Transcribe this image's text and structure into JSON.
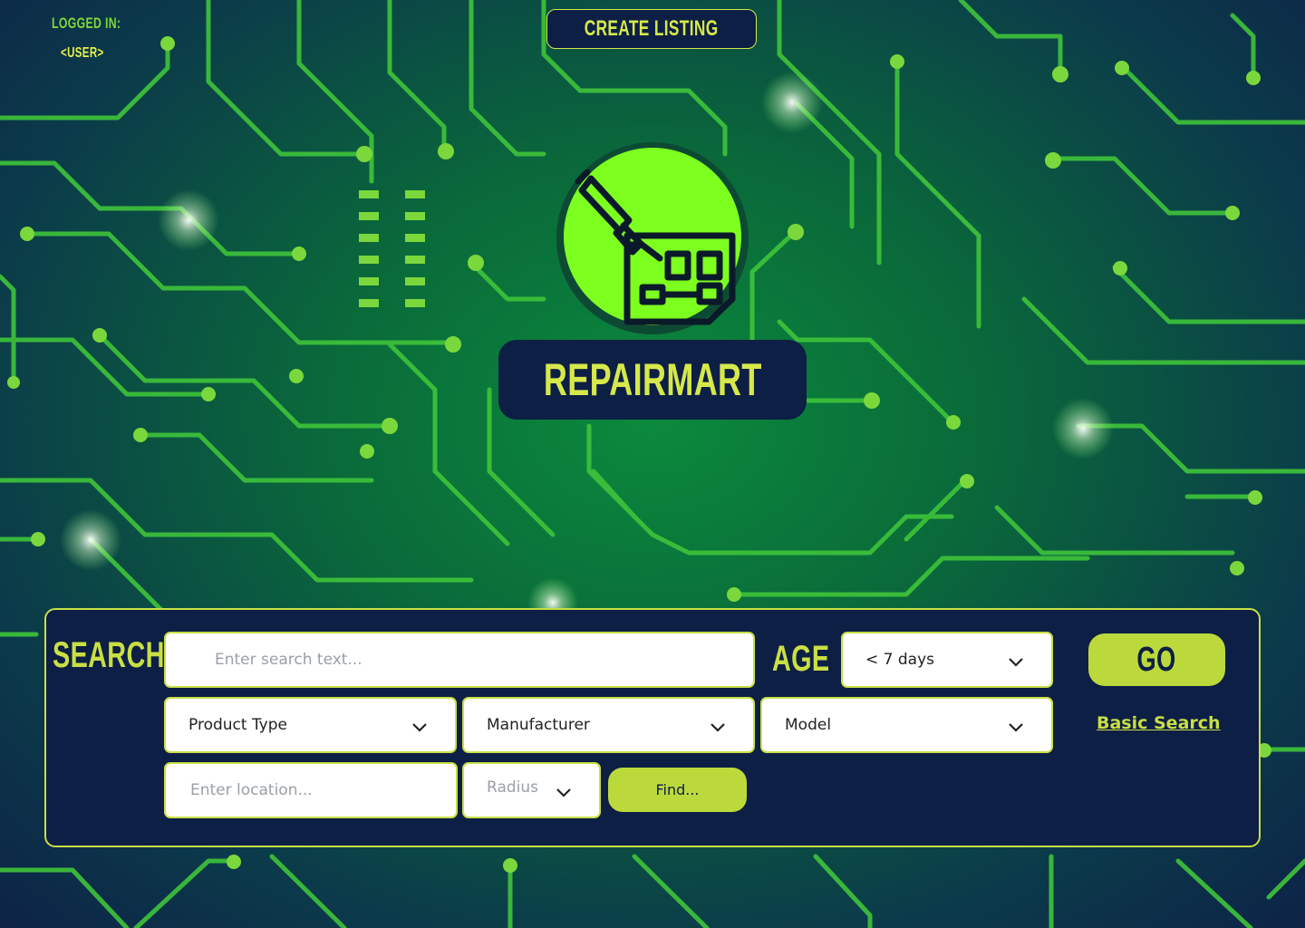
{
  "header": {
    "logged_in_label": "LOGGED IN:",
    "user_link": "<USER>",
    "create_listing": "CREATE LISTING"
  },
  "brand": {
    "name": "REPAIRMART",
    "logo_icon": "soldering-iron-circuit-board-icon"
  },
  "search": {
    "label": "SEARCH",
    "input_placeholder": "Enter search text...",
    "age_label": "AGE",
    "age_value": "< 7 days",
    "go_label": "GO",
    "basic_search_link": "Basic Search",
    "product_type": "Product Type",
    "manufacturer": "Manufacturer",
    "model": "Model",
    "location_placeholder": "Enter location...",
    "radius": "Radius",
    "find_label": "Find..."
  },
  "colors": {
    "accent": "#c9df44",
    "panel": "#0d1f45",
    "logo_green": "#7dff1f"
  }
}
